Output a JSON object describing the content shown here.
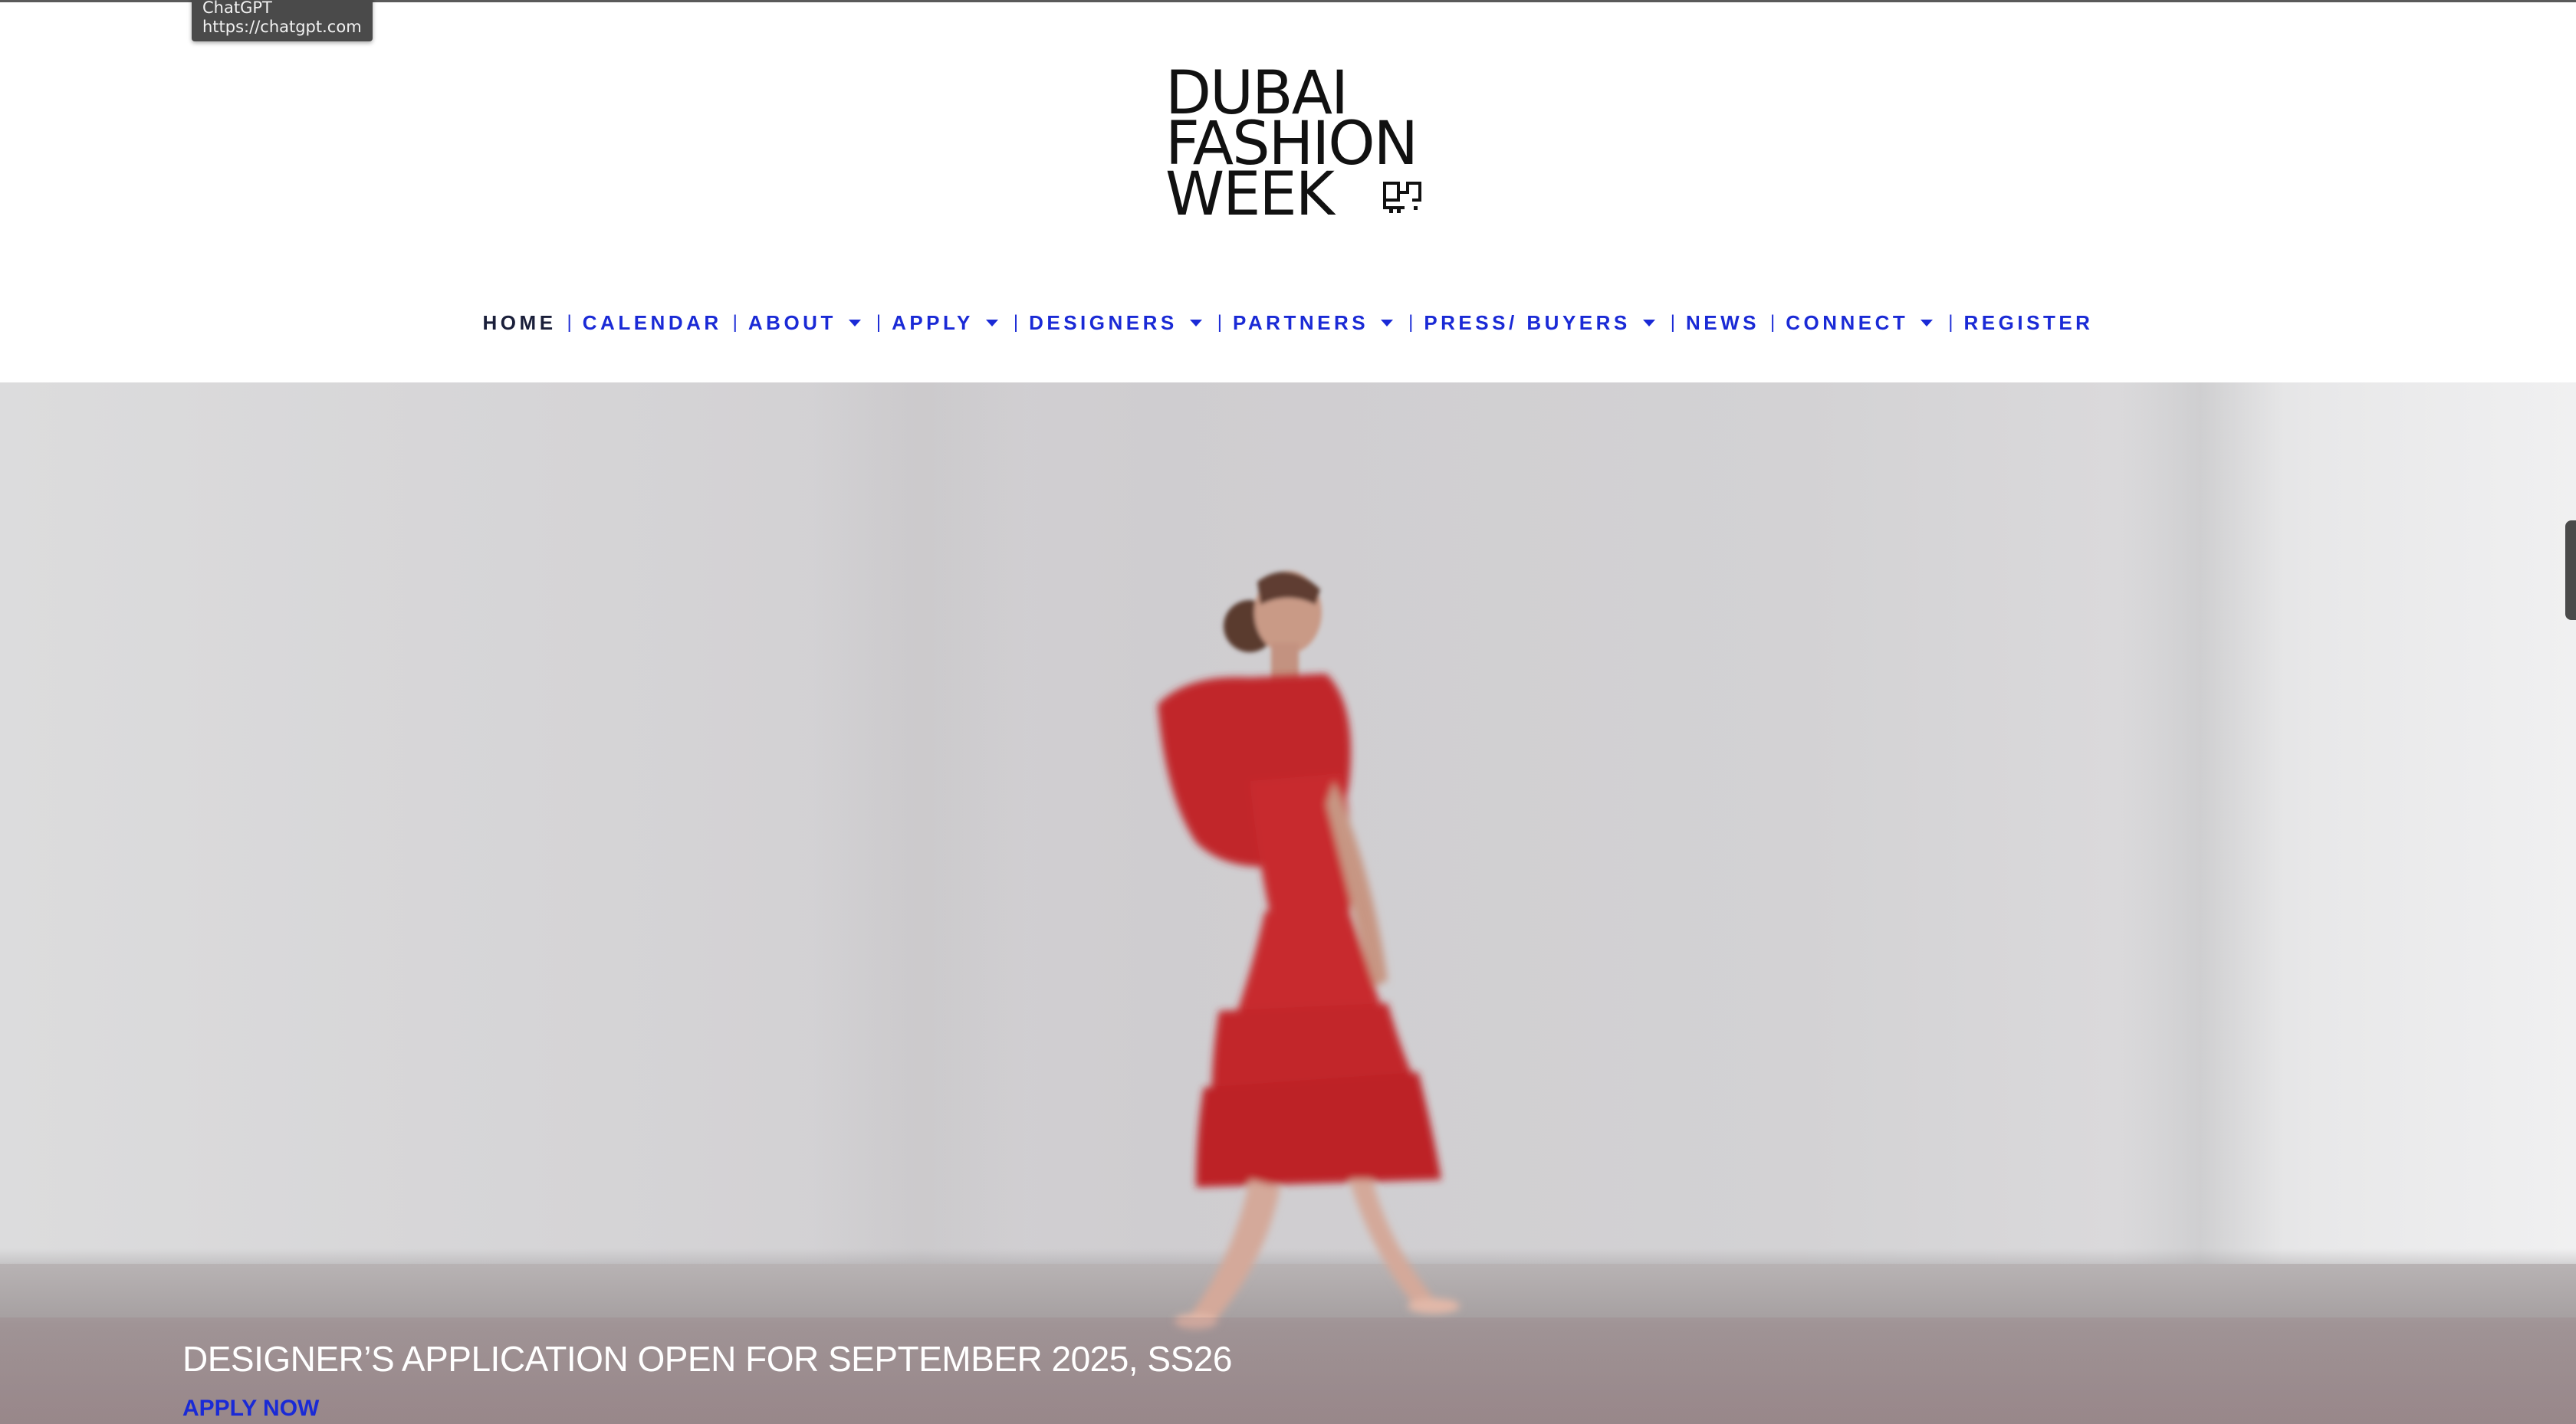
{
  "tooltip": {
    "title": "ChatGPT",
    "url": "https://chatgpt.com"
  },
  "logo": {
    "line1": "DUBAI",
    "line2": "FASHION",
    "line3": "WEEK"
  },
  "nav": {
    "items": [
      {
        "label": "HOME",
        "active": true,
        "dropdown": false
      },
      {
        "label": "CALENDAR",
        "active": false,
        "dropdown": false
      },
      {
        "label": "ABOUT",
        "active": false,
        "dropdown": true
      },
      {
        "label": "APPLY",
        "active": false,
        "dropdown": true
      },
      {
        "label": "DESIGNERS",
        "active": false,
        "dropdown": true
      },
      {
        "label": "PARTNERS",
        "active": false,
        "dropdown": true
      },
      {
        "label": "PRESS/ BUYERS",
        "active": false,
        "dropdown": true
      },
      {
        "label": "NEWS",
        "active": false,
        "dropdown": false
      },
      {
        "label": "CONNECT",
        "active": false,
        "dropdown": true
      },
      {
        "label": "REGISTER",
        "active": false,
        "dropdown": false
      }
    ],
    "separator": "|"
  },
  "hero": {
    "title": "DESIGNER’S APPLICATION OPEN FOR SEPTEMBER 2025, SS26",
    "cta": "APPLY NOW"
  },
  "colors": {
    "nav_link": "#1a2ad6",
    "nav_active": "#1a1f3a",
    "dress": "#c8282c"
  }
}
